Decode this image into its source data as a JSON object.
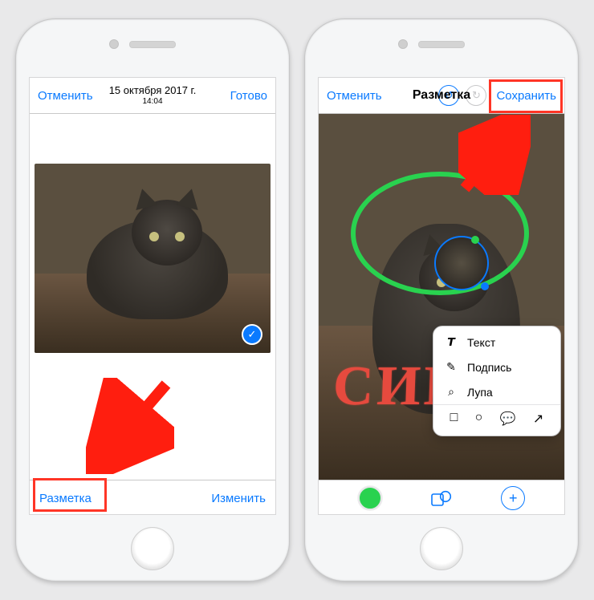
{
  "left": {
    "cancel": "Отменить",
    "done": "Готово",
    "date": "15 октября 2017 г.",
    "time": "14:04",
    "markup": "Разметка",
    "edit": "Изменить",
    "checkmark": "✓"
  },
  "right": {
    "cancel": "Отменить",
    "title": "Разметка",
    "save": "Сохранить",
    "undoGlyph": "↺",
    "redoGlyph": "↻",
    "handwriting": "СИМА",
    "menu": {
      "text": "Текст",
      "signature": "Подпись",
      "magnifier": "Лупа",
      "shapes": {
        "square": "□",
        "circle": "○",
        "bubble": "💬",
        "arrow": "↗"
      }
    },
    "toolbar": {
      "shapesGlyph": "▱",
      "plusGlyph": "+"
    }
  }
}
